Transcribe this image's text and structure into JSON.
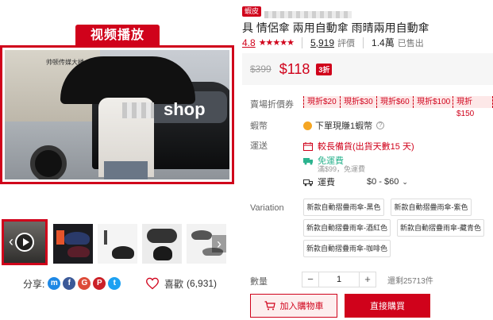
{
  "media": {
    "video_tag": "视频播放",
    "overlay_text": "shop",
    "building_sign": "帅顿传媒大楼"
  },
  "share": {
    "label": "分享:",
    "icons": [
      "messenger-icon",
      "facebook-icon",
      "google-plus-icon",
      "pinterest-icon",
      "twitter-icon"
    ]
  },
  "like": {
    "label": "喜歡",
    "count": "(6,931)"
  },
  "product": {
    "badge": "蝦皮",
    "title": "具 情侶傘 兩用自動傘 雨晴兩用自動傘",
    "rating": "4.8",
    "stars": "★★★★★",
    "reviews_count": "5,919",
    "reviews_label": "評價",
    "sold_count": "1.4萬",
    "sold_label": "已售出"
  },
  "price": {
    "original": "$399",
    "current": "$118",
    "discount": "3折"
  },
  "vouchers": {
    "label": "賣場折價券",
    "items": [
      "現折$20",
      "現折$30",
      "現折$60",
      "現折$100",
      "現折$150"
    ]
  },
  "coins": {
    "label": "蝦幣",
    "text": "下單現賺1蝦幣",
    "help": "?"
  },
  "shipping": {
    "label": "運送",
    "long_wait": "較長備貨(出貨天數15 天)",
    "free_label": "免運費",
    "free_sub": "滿$99，免運費",
    "fee_label": "運費",
    "fee_range": "$0 - $60",
    "chevron": "⌄"
  },
  "variation": {
    "label": "Variation",
    "options": [
      "新款自動摺疊雨傘-黑色",
      "新款自動摺疊雨傘-紫色",
      "新款自動摺疊雨傘-酒紅色",
      "新款自動摺疊雨傘-藏青色",
      "新款自動摺疊雨傘-咖啡色"
    ]
  },
  "quantity": {
    "label": "數量",
    "minus": "−",
    "value": "1",
    "plus": "+",
    "stock": "還剩25713件"
  },
  "actions": {
    "add_to_cart": "加入購物車",
    "buy_now": "直接購買"
  },
  "colors": {
    "brand": "#d0021b",
    "free_ship": "#2bb38e"
  }
}
